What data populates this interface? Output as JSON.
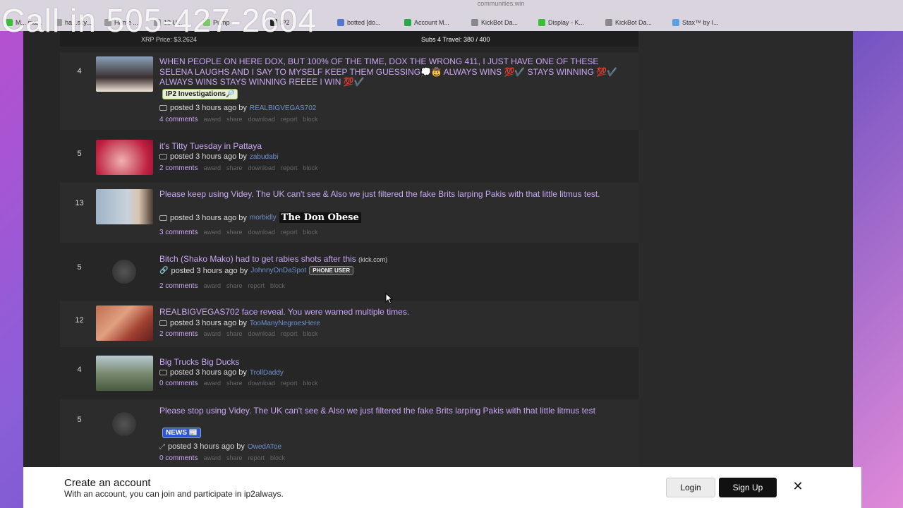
{
  "browser": {
    "url_ghost": "communities.win",
    "tabs": [
      {
        "label": "M... ma...",
        "icon": "kickbot-icon",
        "color": "#3bbf3b"
      },
      {
        "label": "ha...sky...",
        "icon": "globe-icon",
        "color": "#999999"
      },
      {
        "label": "Home ...",
        "icon": "globe-icon",
        "color": "#999999"
      },
      {
        "label": "12 U...",
        "icon": "globe-icon",
        "color": "#999999"
      },
      {
        "label": "Pump",
        "icon": "pump-icon",
        "color": "#7ac96a"
      },
      {
        "label": "IP2",
        "icon": "s-icon",
        "color": "#222222"
      },
      {
        "label": "botted [do...",
        "icon": "doc-icon",
        "color": "#5577cc"
      },
      {
        "label": "Account M...",
        "icon": "ck-icon",
        "color": "#2aa84a"
      },
      {
        "label": "KickBot Da...",
        "icon": "k-icon",
        "color": "#888888"
      },
      {
        "label": "Display - K...",
        "icon": "kickbot-icon",
        "color": "#3bbf3b"
      },
      {
        "label": "KickBot Da...",
        "icon": "k-icon",
        "color": "#888888"
      },
      {
        "label": "Stax™ by I...",
        "icon": "stax-icon",
        "color": "#5aa0e0"
      }
    ]
  },
  "overlay": {
    "phone": "Call in 505-427-2604"
  },
  "banner": {
    "price": "XRP Price: $3.2624",
    "subs": "Subs 4 Travel: 380 / 400"
  },
  "posts": [
    {
      "score": "4",
      "title": "WHEN PEOPLE ON HERE DOX, BUT 100% OF THE TIME, DOX THE WRONG 411, I JUST HAVE ONE OF THESE SELENA LAUGHS AND I SAY TO MYSELF KEEP THEM GUESSING💭🤠    ALWAYS WINS 💯✔️ STAYS WINNING 💯✔️ ALWAYS WINS STAYS WINNING REEEE I WIN 💯✔️",
      "flair": "IP2 Investigations🔎",
      "posted": "posted 3 hours ago by",
      "user": "REALBIGVEGAS702",
      "comments": "4 comments",
      "actions": [
        "award",
        "share",
        "download",
        "report",
        "block"
      ]
    },
    {
      "score": "5",
      "title": "it's Titty Tuesday in Pattaya",
      "posted": "posted 3 hours ago by",
      "user": "zabudabi",
      "comments": "2 comments",
      "actions": [
        "award",
        "share",
        "download",
        "report",
        "block"
      ]
    },
    {
      "score": "13",
      "title": "Please keep using Videy. The UK can't see & Also we just filtered the fake Brits larping Pakis with that little litmus test.",
      "posted": "posted 3 hours ago by",
      "user": "morbidly",
      "user_flair": "The Don Obese",
      "comments": "3 comments",
      "actions": [
        "award",
        "share",
        "download",
        "report",
        "block"
      ]
    },
    {
      "score": "5",
      "title": "Bitch (Shako Mako) had to get rabies shots after this",
      "domain": "(kick.com)",
      "posted": "posted 3 hours ago by",
      "user": "JohnnyOnDaSpot",
      "user_flair": "PHONE USER",
      "comments": "2 comments",
      "actions": [
        "award",
        "share",
        "report",
        "block"
      ]
    },
    {
      "score": "12",
      "title": "REALBIGVEGAS702 face reveal. You were warned multiple times.",
      "posted": "posted 3 hours ago by",
      "user": "TooManyNegroesHere",
      "comments": "2 comments",
      "actions": [
        "award",
        "share",
        "download",
        "report",
        "block"
      ]
    },
    {
      "score": "4",
      "title": "Big Trucks Big Ducks",
      "posted": "posted 3 hours ago by",
      "user": "TrollDaddy",
      "comments": "0 comments",
      "actions": [
        "award",
        "share",
        "download",
        "report",
        "block"
      ]
    },
    {
      "score": "5",
      "title": "Please stop using Videy. The UK can't see & Also we just filtered the fake Brits larping Pakis with that little litmus test",
      "flair": "NEWS 📰",
      "posted": "posted 3 hours ago by",
      "user": "OwedAToe",
      "comments": "0 comments",
      "actions": [
        "award",
        "share",
        "report",
        "block"
      ]
    }
  ],
  "signup": {
    "heading": "Create an account",
    "text": "With an account, you can join and participate in ip2always.",
    "login": "Login",
    "signup": "Sign Up",
    "close": "✕"
  }
}
